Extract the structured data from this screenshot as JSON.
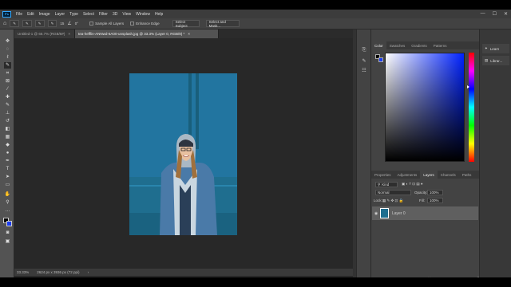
{
  "app": {
    "logo": "Ps"
  },
  "menu": [
    "File",
    "Edit",
    "Image",
    "Layer",
    "Type",
    "Select",
    "Filter",
    "3D",
    "View",
    "Window",
    "Help"
  ],
  "window_controls": [
    "—",
    "☐",
    "✕"
  ],
  "options": {
    "size": "15",
    "angle": "0°",
    "sample_all_layers": "Sample All Layers",
    "enhance_edge": "Enhance Edge",
    "select_subject": "Select Subject",
    "select_and_mask": "Select and Mask..."
  },
  "tabs": [
    {
      "label": "Untitled-1 @ 66.7% (RGB/8#)",
      "close": "×",
      "active": false
    },
    {
      "label": "tea-hefflin-ANNwd-6A00-unsplash.jpg @ 33.3% (Layer 0, RGB/8) *",
      "close": "×",
      "active": true
    }
  ],
  "status": {
    "zoom": "33.33%",
    "doc_size": "2624 px x 3936 px (72 ppi)"
  },
  "color_panel": {
    "tabs": [
      "Color",
      "Swatches",
      "Gradients",
      "Patterns"
    ],
    "hue_color": "#0022ff"
  },
  "learn_panel": {
    "items": [
      "Learn",
      "Librar..."
    ]
  },
  "layers_panel": {
    "tabs": [
      "Properties",
      "Adjustments",
      "Layers",
      "Channels",
      "Paths"
    ],
    "kind": "Kind",
    "blend_mode": "Normal",
    "opacity_label": "Opacity:",
    "opacity_value": "100%",
    "lock_label": "Lock:",
    "fill_label": "Fill:",
    "fill_value": "100%",
    "layer_name": "Layer 0"
  },
  "colors": {
    "foreground": "#000000",
    "background": "#1a3cf0",
    "accent": "#31a8ff",
    "photo_bg": "#1f6e8f"
  }
}
